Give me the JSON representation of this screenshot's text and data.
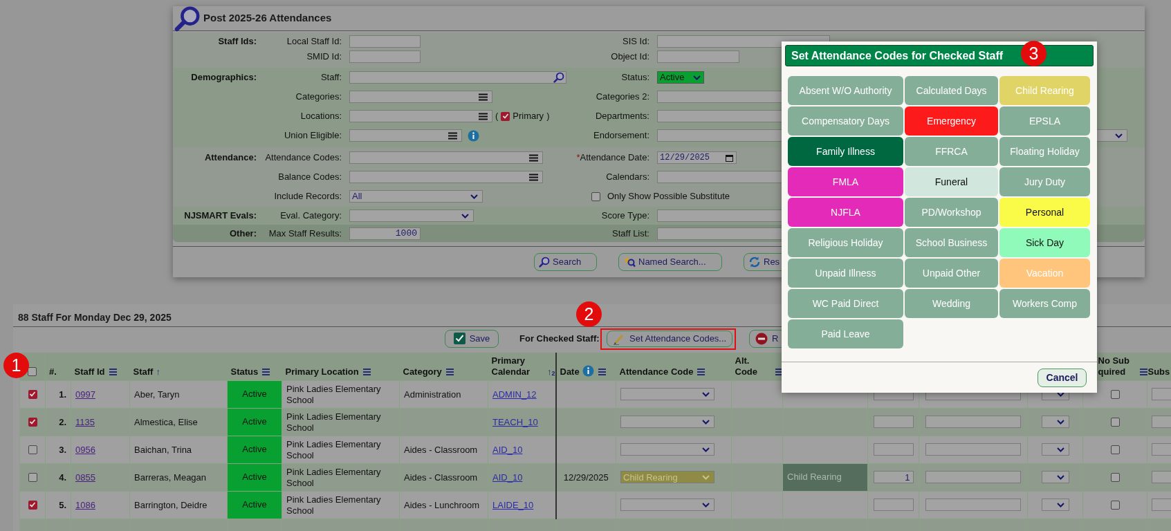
{
  "search_panel": {
    "title": "Post 2025-26 Attendances",
    "sections": [
      {
        "label": "Staff Ids:",
        "rows": [
          {
            "left": {
              "label": "Local Staff Id:",
              "kind": "text"
            },
            "right": {
              "label": "SIS Id:",
              "kind": "text"
            }
          },
          {
            "left": {
              "label": "SMID Id:",
              "kind": "text"
            },
            "right": {
              "label": "Object Id:",
              "kind": "text"
            }
          }
        ]
      },
      {
        "label": "Demographics:",
        "rows": [
          {
            "left": {
              "label": "Staff:",
              "kind": "lookup"
            },
            "right": {
              "label": "Status:",
              "kind": "status_select",
              "value": "Active"
            }
          },
          {
            "left": {
              "label": "Categories:",
              "kind": "multi"
            },
            "right": {
              "label": "Categories 2:",
              "kind": "text"
            }
          },
          {
            "left": {
              "label": "Locations:",
              "kind": "multi",
              "option": {
                "open": "(",
                "label": "Primary",
                "close": ")",
                "checked": true
              }
            },
            "right": {
              "label": "Departments:",
              "kind": "text"
            }
          },
          {
            "left": {
              "label": "Union Eligible:",
              "kind": "multi"
            },
            "right": {
              "label": "Endorsement:",
              "kind": "select"
            }
          }
        ]
      },
      {
        "label": "Attendance:",
        "rows": [
          {
            "left": {
              "label": "Attendance Codes:",
              "kind": "multi"
            },
            "right": {
              "label": "Attendance Date:",
              "required_mark": "*",
              "kind": "date",
              "value": "12/29/2025"
            }
          },
          {
            "left": {
              "label": "Balance Codes:",
              "kind": "multi"
            },
            "right": {
              "label": "Calendars:",
              "kind": "text"
            }
          },
          {
            "left": {
              "label": "Include Records:",
              "kind": "select",
              "value": "All"
            },
            "right": {
              "label": "Only Show Possible Substitute",
              "kind": "checkbox",
              "checked": false
            }
          }
        ]
      },
      {
        "label": "NJSMART Evals:",
        "rows": [
          {
            "left": {
              "label": "Eval. Category:",
              "kind": "select"
            },
            "right": {
              "label": "Score Type:",
              "kind": "text"
            }
          }
        ]
      },
      {
        "label": "Other:",
        "rows": [
          {
            "left": {
              "label": "Max Staff Results:",
              "kind": "number",
              "value": "1000"
            },
            "right": {
              "label": "Staff List:",
              "kind": "text"
            }
          }
        ]
      }
    ],
    "buttons": [
      "Search",
      "Named Search...",
      "Res"
    ]
  },
  "results": {
    "title": "88 Staff For Monday Dec 29, 2025",
    "toolbar": {
      "save": "Save",
      "label": "For Checked Staff:",
      "set_codes": "Set Attendance Codes...",
      "remove": "R"
    },
    "select_all_checked": false,
    "columns": [
      {
        "label": "#."
      },
      {
        "label": "Staff Id"
      },
      {
        "label": "Staff",
        "sort_arrow": "↑"
      },
      {
        "label": "Status"
      },
      {
        "label": "Primary Location"
      },
      {
        "label": "Category"
      },
      {
        "label": "Primary Calendar",
        "sort_arrow": "↑",
        "sort_rank": "2"
      },
      {
        "label": "Date"
      },
      {
        "label": "Attendance Code"
      },
      {
        "label": "Alt. Code"
      },
      {
        "label": "No Sub quired"
      },
      {
        "label": "Subs"
      }
    ],
    "rows": [
      {
        "checked": true,
        "number": "1.",
        "staff_id": "0997",
        "staff": "Aber, Taryn",
        "status": "Active",
        "location": "Pink Ladies Elementary School",
        "category": "Administration",
        "calendar": "ADMIN_12",
        "no_sub_checked": false
      },
      {
        "checked": true,
        "number": "2.",
        "staff_id": "1135",
        "staff": "Almestica, Elise",
        "status": "Active",
        "location": "Pink Ladies Elementary School",
        "calendar": "TEACH_10",
        "no_sub_checked": false
      },
      {
        "checked": false,
        "number": "3.",
        "staff_id": "0956",
        "staff": "Baichan, Trina",
        "status": "Active",
        "location": "Pink Ladies Elementary School",
        "category": "Aides - Classroom",
        "calendar": "AID_10",
        "no_sub_checked": false
      },
      {
        "checked": false,
        "number": "4.",
        "staff_id": "0855",
        "staff": "Barreras, Meagan",
        "status": "Active",
        "location": "Pink Ladies Elementary School",
        "category": "Aides - Classroom",
        "calendar": "AID_10",
        "date": "12/29/2025",
        "attendance_code": "Child Rearing",
        "column_12": "Child Rearing",
        "column_13": "1",
        "no_sub_checked": false
      },
      {
        "checked": true,
        "number": "5.",
        "staff_id": "1086",
        "staff": "Barrington, Deidre",
        "status": "Active",
        "location": "Pink Ladies Elementary School",
        "category": "Aides - Lunchroom",
        "calendar": "LAIDE_10",
        "no_sub_checked": false
      }
    ]
  },
  "code_dialog": {
    "title": "Set Attendance Codes for Checked Staff",
    "codes": [
      {
        "label": "Absent W/O Authority",
        "color": "#85ae99",
        "dark_text": false
      },
      {
        "label": "Calculated Days",
        "color": "#85ae99",
        "dark_text": false
      },
      {
        "label": "Child Rearing",
        "color": "#e1d466",
        "dark_text": false
      },
      {
        "label": "Compensatory Days",
        "color": "#85ae99",
        "dark_text": false
      },
      {
        "label": "Emergency",
        "color": "#fd1a1a",
        "dark_text": false
      },
      {
        "label": "EPSLA",
        "color": "#85ae99",
        "dark_text": false
      },
      {
        "label": "Family Illness",
        "color": "#006840",
        "dark_text": false
      },
      {
        "label": "FFRCA",
        "color": "#85ae99",
        "dark_text": false
      },
      {
        "label": "Floating Holiday",
        "color": "#85ae99",
        "dark_text": false
      },
      {
        "label": "FMLA",
        "color": "#e42ab8",
        "dark_text": false
      },
      {
        "label": "Funeral",
        "color": "#d1e6dd",
        "dark_text": true
      },
      {
        "label": "Jury Duty",
        "color": "#85ae99",
        "dark_text": false
      },
      {
        "label": "NJFLA",
        "color": "#e42ab8",
        "dark_text": false
      },
      {
        "label": "PD/Workshop",
        "color": "#85ae99",
        "dark_text": false
      },
      {
        "label": "Personal",
        "color": "#fafa49",
        "dark_text": true
      },
      {
        "label": "Religious Holiday",
        "color": "#85ae99",
        "dark_text": false
      },
      {
        "label": "School Business",
        "color": "#85ae99",
        "dark_text": false
      },
      {
        "label": "Sick Day",
        "color": "#8ffab9",
        "dark_text": true
      },
      {
        "label": "Unpaid Illness",
        "color": "#85ae99",
        "dark_text": false
      },
      {
        "label": "Unpaid Other",
        "color": "#85ae99",
        "dark_text": false
      },
      {
        "label": "Vacation",
        "color": "#ffc57c",
        "dark_text": false
      },
      {
        "label": "WC Paid Direct",
        "color": "#85ae99",
        "dark_text": false
      },
      {
        "label": "Wedding",
        "color": "#85ae99",
        "dark_text": false
      },
      {
        "label": "Workers Comp",
        "color": "#85ae99",
        "dark_text": false
      },
      {
        "label": "Paid Leave",
        "color": "#85ae99",
        "dark_text": false
      }
    ],
    "cancel": "Cancel"
  },
  "annotations": [
    {
      "label": "1"
    },
    {
      "label": "2"
    },
    {
      "label": "3"
    }
  ]
}
